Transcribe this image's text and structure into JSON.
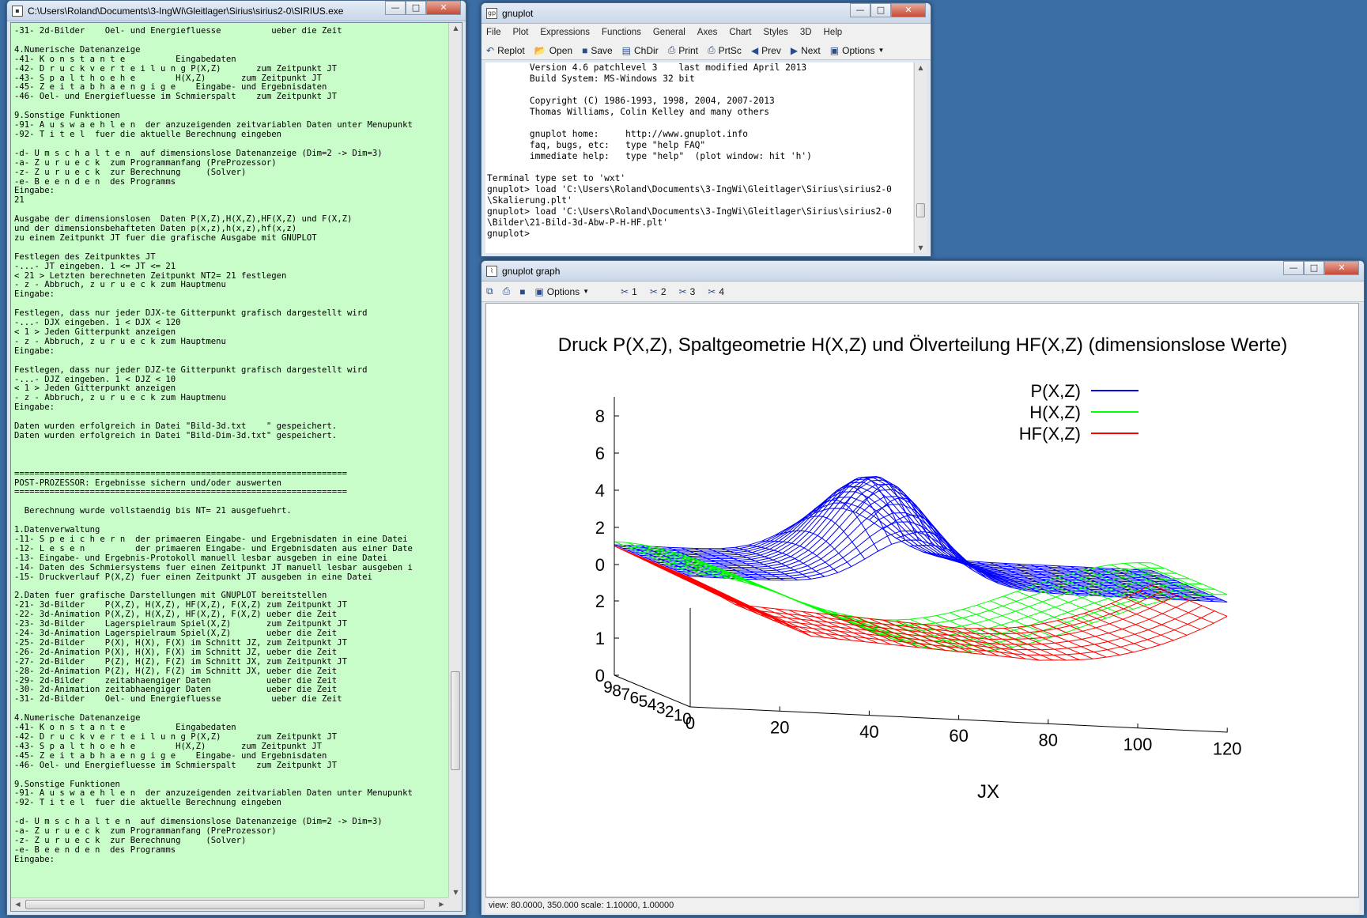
{
  "console": {
    "title": "C:\\Users\\Roland\\Documents\\3-IngWi\\Gleitlager\\Sirius\\sirius2-0\\SIRIUS.exe",
    "lines": [
      "-31- 2d-Bilder    Oel- und Energiefluesse          ueber die Zeit",
      "",
      "4.Numerische Datenanzeige",
      "-41- K o n s t a n t e          Eingabedaten",
      "-42- D r u c k v e r t e i l u n g P(X,Z)       zum Zeitpunkt JT",
      "-43- S p a l t h o e h e        H(X,Z)       zum Zeitpunkt JT",
      "-45- Z e i t a b h a e n g i g e    Eingabe- und Ergebnisdaten",
      "-46- Oel- und Energiefluesse im Schmierspalt    zum Zeitpunkt JT",
      "",
      "9.Sonstige Funktionen",
      "-91- A u s w a e h l e n  der anzuzeigenden zeitvariablen Daten unter Menupunkt",
      "-92- T i t e l  fuer die aktuelle Berechnung eingeben",
      "",
      "-d- U m s c h a l t e n  auf dimensionslose Datenanzeige (Dim=2 -> Dim=3)",
      "-a- Z u r u e c k  zum Programmanfang (PreProzessor)",
      "-z- Z u r u e c k  zur Berechnung     (Solver)",
      "-e- B e e n d e n  des Programms",
      "Eingabe:",
      "21",
      "",
      "Ausgabe der dimensionslosen  Daten P(X,Z),H(X,Z),HF(X,Z) und F(X,Z)",
      "und der dimensionsbehafteten Daten p(x,z),h(x,z),hf(x,z)",
      "zu einem Zeitpunkt JT fuer die grafische Ausgabe mit GNUPLOT",
      "",
      "Festlegen des Zeitpunktes JT",
      "-...- JT eingeben. 1 <= JT <= 21",
      "< 21 > Letzten berechneten Zeitpunkt NT2= 21 festlegen",
      "- z - Abbruch, z u r u e c k zum Hauptmenu",
      "Eingabe:",
      "",
      "Festlegen, dass nur jeder DJX-te Gitterpunkt grafisch dargestellt wird",
      "-...- DJX eingeben. 1 < DJX < 120",
      "< 1 > Jeden Gitterpunkt anzeigen",
      "- z - Abbruch, z u r u e c k zum Hauptmenu",
      "Eingabe:",
      "",
      "Festlegen, dass nur jeder DJZ-te Gitterpunkt grafisch dargestellt wird",
      "-...- DJZ eingeben. 1 < DJZ < 10",
      "< 1 > Jeden Gitterpunkt anzeigen",
      "- z - Abbruch, z u r u e c k zum Hauptmenu",
      "Eingabe:",
      "",
      "Daten wurden erfolgreich in Datei \"Bild-3d.txt    \" gespeichert.",
      "Daten wurden erfolgreich in Datei \"Bild-Dim-3d.txt\" gespeichert.",
      "",
      "",
      "",
      "==================================================================",
      "POST-PROZESSOR: Ergebnisse sichern und/oder auswerten",
      "==================================================================",
      "",
      "  Berechnung wurde vollstaendig bis NT= 21 ausgefuehrt.",
      "",
      "1.Datenverwaltung",
      "-11- S p e i c h e r n  der primaeren Eingabe- und Ergebnisdaten in eine Datei",
      "-12- L e s e n          der primaeren Eingabe- und Ergebnisdaten aus einer Date",
      "-13- Eingabe- und Ergebnis-Protokoll manuell lesbar ausgeben in eine Datei",
      "-14- Daten des Schmiersystems fuer einen Zeitpunkt JT manuell lesbar ausgeben i",
      "-15- Druckverlauf P(X,Z) fuer einen Zeitpunkt JT ausgeben in eine Datei",
      "",
      "2.Daten fuer grafische Darstellungen mit GNUPLOT bereitstellen",
      "-21- 3d-Bilder    P(X,Z), H(X,Z), HF(X,Z), F(X,Z) zum Zeitpunkt JT",
      "-22- 3d-Animation P(X,Z), H(X,Z), HF(X,Z), F(X,Z) ueber die Zeit",
      "-23- 3d-Bilder    Lagerspielraum Spiel(X,Z)       zum Zeitpunkt JT",
      "-24- 3d-Animation Lagerspielraum Spiel(X,Z)       ueber die Zeit",
      "-25- 2d-Bilder    P(X), H(X), F(X) im Schnitt JZ, zum Zeitpunkt JT",
      "-26- 2d-Animation P(X), H(X), F(X) im Schnitt JZ, ueber die Zeit",
      "-27- 2d-Bilder    P(Z), H(Z), F(Z) im Schnitt JX, zum Zeitpunkt JT",
      "-28- 2d-Animation P(Z), H(Z), F(Z) im Schnitt JX, ueber die Zeit",
      "-29- 2d-Bilder    zeitabhaengiger Daten           ueber die Zeit",
      "-30- 2d-Animation zeitabhaengiger Daten           ueber die Zeit",
      "-31- 2d-Bilder    Oel- und Energiefluesse          ueber die Zeit",
      "",
      "4.Numerische Datenanzeige",
      "-41- K o n s t a n t e          Eingabedaten",
      "-42- D r u c k v e r t e i l u n g P(X,Z)       zum Zeitpunkt JT",
      "-43- S p a l t h o e h e        H(X,Z)       zum Zeitpunkt JT",
      "-45- Z e i t a b h a e n g i g e    Eingabe- und Ergebnisdaten",
      "-46- Oel- und Energiefluesse im Schmierspalt    zum Zeitpunkt JT",
      "",
      "9.Sonstige Funktionen",
      "-91- A u s w a e h l e n  der anzuzeigenden zeitvariablen Daten unter Menupunkt",
      "-92- T i t e l  fuer die aktuelle Berechnung eingeben",
      "",
      "-d- U m s c h a l t e n  auf dimensionslose Datenanzeige (Dim=2 -> Dim=3)",
      "-a- Z u r u e c k  zum Programmanfang (PreProzessor)",
      "-z- Z u r u e c k  zur Berechnung     (Solver)",
      "-e- B e e n d e n  des Programms",
      "Eingabe:"
    ]
  },
  "gnuplot": {
    "title": "gnuplot",
    "menu": [
      "File",
      "Plot",
      "Expressions",
      "Functions",
      "General",
      "Axes",
      "Chart",
      "Styles",
      "3D",
      "Help"
    ],
    "toolbar": [
      "Replot",
      "Open",
      "Save",
      "ChDir",
      "Print",
      "PrtSc",
      "Prev",
      "Next",
      "Options"
    ],
    "lines": [
      "        Version 4.6 patchlevel 3    last modified April 2013",
      "        Build System: MS-Windows 32 bit",
      "",
      "        Copyright (C) 1986-1993, 1998, 2004, 2007-2013",
      "        Thomas Williams, Colin Kelley and many others",
      "",
      "        gnuplot home:     http://www.gnuplot.info",
      "        faq, bugs, etc:   type \"help FAQ\"",
      "        immediate help:   type \"help\"  (plot window: hit 'h')",
      "",
      "Terminal type set to 'wxt'",
      "gnuplot> load 'C:\\Users\\Roland\\Documents\\3-IngWi\\Gleitlager\\Sirius\\sirius2-0",
      "\\Skalierung.plt'",
      "gnuplot> load 'C:\\Users\\Roland\\Documents\\3-IngWi\\Gleitlager\\Sirius\\sirius2-0",
      "\\Bilder\\21-Bild-3d-Abw-P-H-HF.plt'",
      "gnuplot>"
    ]
  },
  "graph": {
    "title": "gnuplot graph",
    "toolbar_options": "Options",
    "toolbar_toggles": [
      "1",
      "2",
      "3",
      "4"
    ],
    "status": "view: 80.0000, 350.000   scale: 1.10000, 1.00000"
  },
  "chart_data": {
    "type": "surface3d",
    "title": "Druck P(X,Z), Spaltgeometrie H(X,Z) und Ölverteilung HF(X,Z) (dimensionslose Werte)",
    "xlabel": "JX",
    "x_ticks": [
      "0",
      "20",
      "40",
      "60",
      "80",
      "100",
      "120"
    ],
    "z_ticks_upper": [
      "0",
      "2",
      "4",
      "6",
      "8"
    ],
    "z_ticks_lower": [
      "0",
      "1",
      "2"
    ],
    "y_ticks": [
      "9",
      "8",
      "7",
      "6",
      "5",
      "4",
      "3",
      "2",
      "1",
      "0"
    ],
    "xlim": [
      0,
      120
    ],
    "legend": "top-right",
    "series": [
      {
        "name": "P(X,Z)",
        "color": "#0000ff",
        "peak_value": 4.6,
        "peak_x": 50,
        "base_value": 0
      },
      {
        "name": "H(X,Z)",
        "color": "#00ff00",
        "start_value": 1.8,
        "min_value": 0.3,
        "min_x": 60,
        "end_value": 1.9
      },
      {
        "name": "HF(X,Z)",
        "color": "#ff0000",
        "start_value": 1.7,
        "end_value": 1.4
      }
    ]
  }
}
